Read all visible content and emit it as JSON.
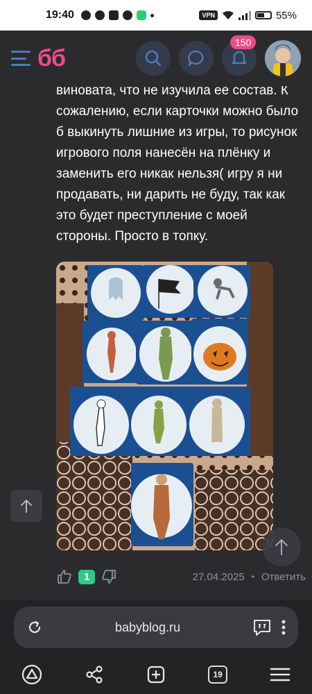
{
  "status_bar": {
    "time": "19:40",
    "vpn": "VPN",
    "battery": "55%"
  },
  "header": {
    "logo": "бб",
    "notifications_count": "150"
  },
  "comment": {
    "text": "виновата, что не изучила её состав. К сожалению, если карточки можно было б выкинуть лишние из игры, то рисунок игрового поля нанесён на плёнку и заменить его никак нельзя( игру я ни продавать, ни дарить не буду, так как это будет преступление с моей стороны. Просто в топку.",
    "likes": "1",
    "date": "27.04.2025",
    "separator": "•",
    "reply_label": "Ответить"
  },
  "browser": {
    "url": "babyblog.ru",
    "tab_count": "19"
  },
  "colors": {
    "accent": "#ec4d86",
    "icon_blue": "#4a7fc0",
    "like_green": "#2fc98a"
  }
}
